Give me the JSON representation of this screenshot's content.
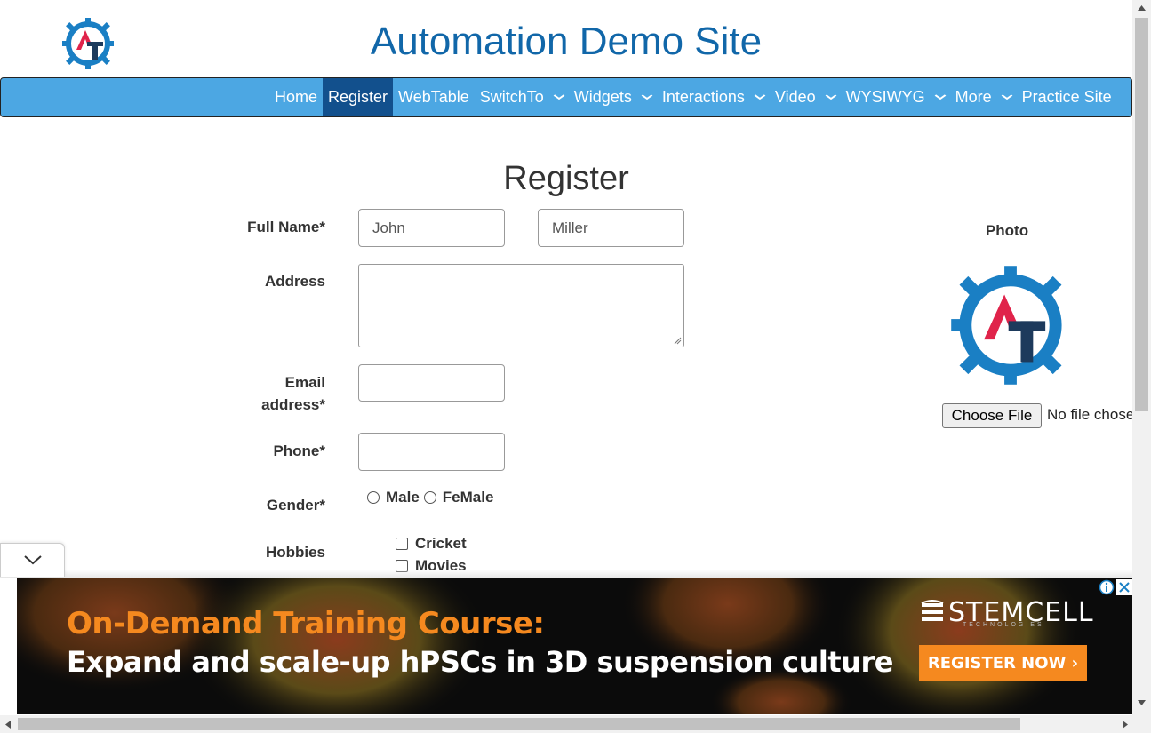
{
  "header": {
    "site_title": "Automation Demo Site",
    "logo_icon": "automation-testing-gear-logo"
  },
  "nav": {
    "items": [
      {
        "label": "Home",
        "active": false,
        "dropdown": false
      },
      {
        "label": "Register",
        "active": true,
        "dropdown": false
      },
      {
        "label": "WebTable",
        "active": false,
        "dropdown": false
      },
      {
        "label": "SwitchTo",
        "active": false,
        "dropdown": true
      },
      {
        "label": "Widgets",
        "active": false,
        "dropdown": true
      },
      {
        "label": "Interactions",
        "active": false,
        "dropdown": true
      },
      {
        "label": "Video",
        "active": false,
        "dropdown": true
      },
      {
        "label": "WYSIWYG",
        "active": false,
        "dropdown": true
      },
      {
        "label": "More",
        "active": false,
        "dropdown": true
      },
      {
        "label": "Practice Site",
        "active": false,
        "dropdown": false
      }
    ],
    "bg_color": "#4ca7e3",
    "active_color": "#12508d"
  },
  "form": {
    "title": "Register",
    "full_name_label": "Full Name*",
    "first_name_value": "John",
    "last_name_value": "Miller",
    "address_label": "Address",
    "address_value": "",
    "email_label_line1": "Email",
    "email_label_line2": "address*",
    "email_value": "",
    "phone_label": "Phone*",
    "phone_value": "",
    "gender_label": "Gender*",
    "gender_options": [
      "Male",
      "FeMale"
    ],
    "hobbies_label": "Hobbies",
    "hobbies_options": [
      "Cricket",
      "Movies"
    ]
  },
  "photo": {
    "label": "Photo",
    "choose_file_label": "Choose File",
    "file_status": "No file chosen"
  },
  "ad": {
    "headline": "On-Demand Training Course:",
    "subline": "Expand and scale-up hPSCs in 3D suspension culture",
    "brand": "STEMCELL",
    "brand_tag": "TECHNOLOGIES",
    "cta": "REGISTER NOW ›",
    "headline_color": "#f5891f",
    "cta_color": "#f5891f"
  }
}
